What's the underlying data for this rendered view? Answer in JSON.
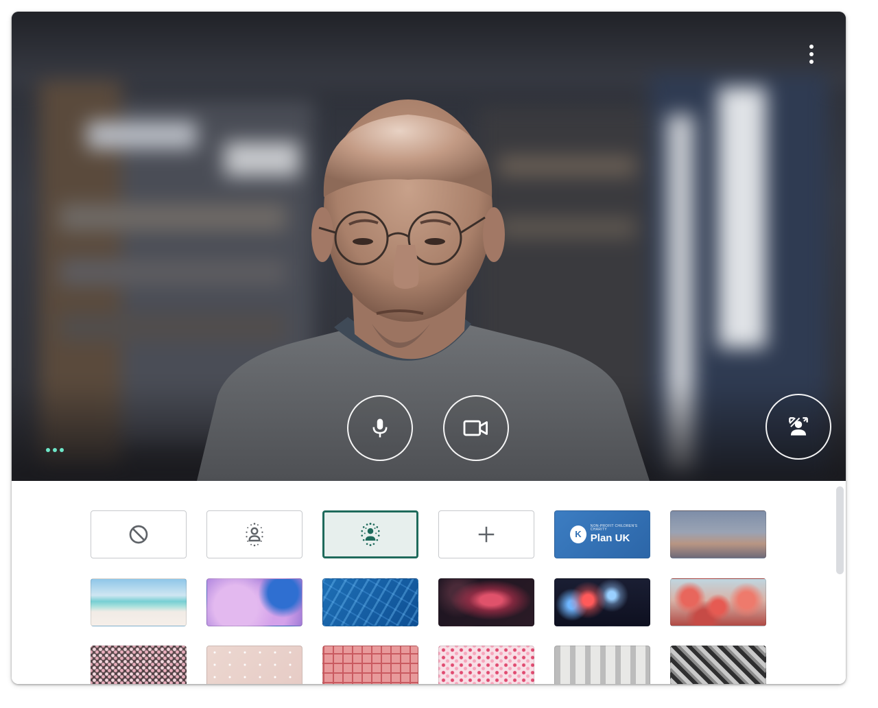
{
  "preview": {
    "more_options_icon": "more-vert-icon",
    "mic_icon": "microphone-icon",
    "camera_icon": "videocam-icon",
    "effects_icon": "person-background-icon"
  },
  "backgrounds": {
    "options": [
      {
        "kind": "none",
        "icon": "block-icon"
      },
      {
        "kind": "slight-blur",
        "icon": "blur-slight-icon"
      },
      {
        "kind": "blur",
        "icon": "blur-icon",
        "selected": true
      },
      {
        "kind": "add",
        "icon": "plus-icon"
      },
      {
        "kind": "brand",
        "label_small": "NON-PROFIT CHILDREN'S CHARITY",
        "label": "Plan UK",
        "logo_letter": "K",
        "color": "#2f6fb3"
      },
      {
        "kind": "image",
        "theme": "sunset-horizon"
      },
      {
        "kind": "image",
        "theme": "beach"
      },
      {
        "kind": "image",
        "theme": "pastel-clouds"
      },
      {
        "kind": "image",
        "theme": "pool-water"
      },
      {
        "kind": "image",
        "theme": "nebula"
      },
      {
        "kind": "image",
        "theme": "fireworks"
      },
      {
        "kind": "image",
        "theme": "pink-blossoms"
      },
      {
        "kind": "image",
        "theme": "flowers"
      },
      {
        "kind": "image",
        "theme": "pink-confetti-dots"
      },
      {
        "kind": "image",
        "theme": "pink-pattern"
      },
      {
        "kind": "image",
        "theme": "petals"
      },
      {
        "kind": "image",
        "theme": "gallery-room"
      },
      {
        "kind": "image",
        "theme": "bw-architecture"
      }
    ]
  },
  "colors": {
    "selected_border": "#1e6a5b",
    "selected_fill": "#e7efed",
    "activity_dots": "#6ee6c8"
  }
}
